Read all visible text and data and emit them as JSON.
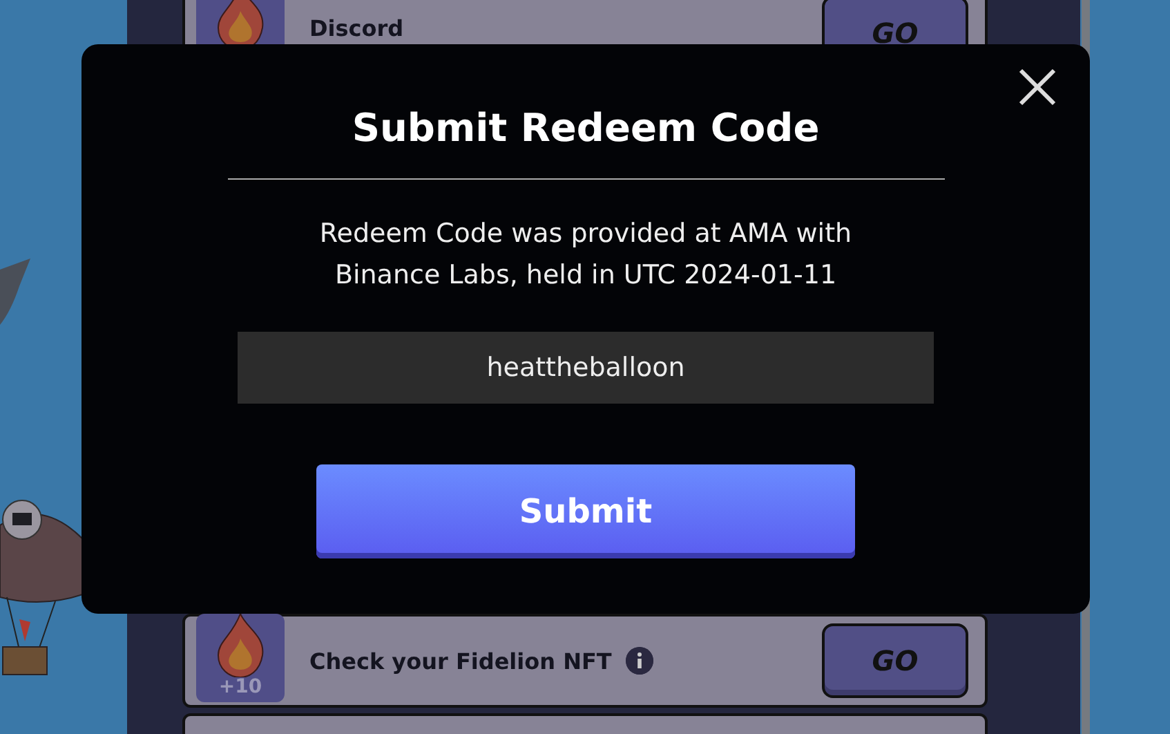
{
  "quests": [
    {
      "title": "Discord",
      "button": "GO",
      "info": false
    },
    {
      "title": "Check your Fidelion NFT",
      "points": "+10",
      "button": "GO",
      "info": true
    }
  ],
  "modal": {
    "title": "Submit Redeem Code",
    "description": "Redeem Code was provided at AMA with Binance Labs, held in UTC 2024-01-11",
    "code": "heattheballoon",
    "submit": "Submit"
  }
}
